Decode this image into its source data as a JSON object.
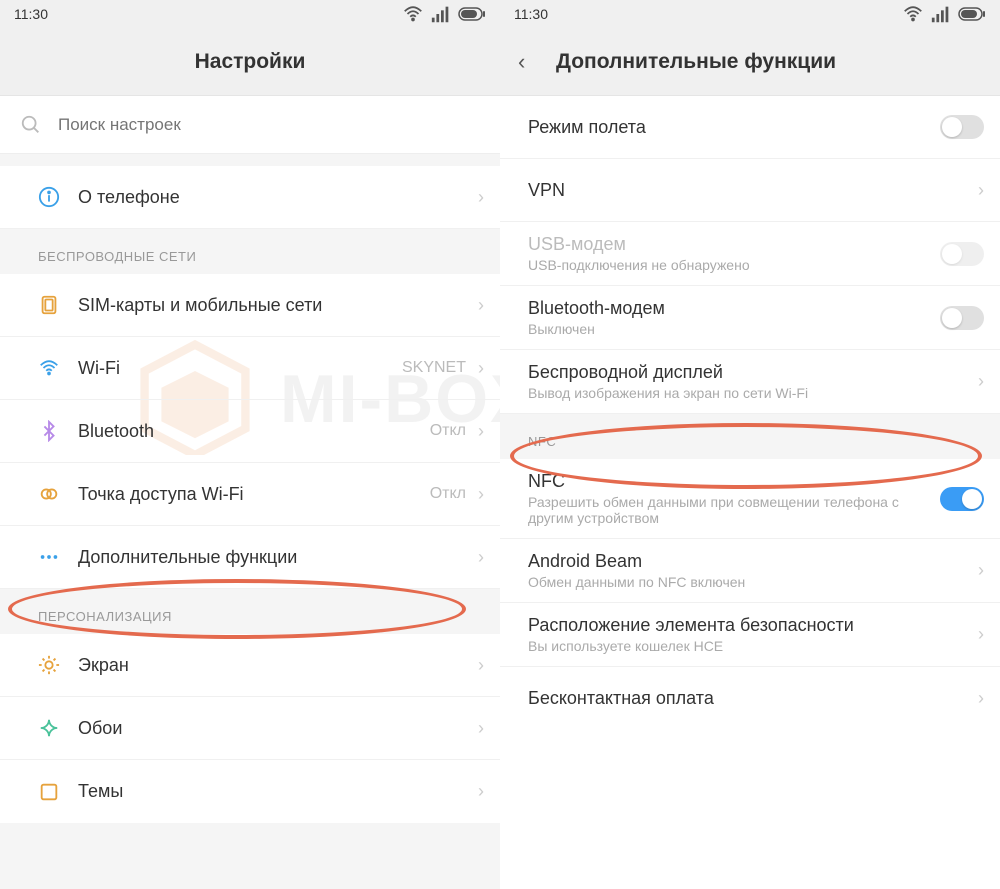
{
  "status": {
    "time": "11:30"
  },
  "left": {
    "title": "Настройки",
    "search_placeholder": "Поиск настроек",
    "about": "О телефоне",
    "section_wireless": "БЕСПРОВОДНЫЕ СЕТИ",
    "sim": "SIM-карты и мобильные сети",
    "wifi": {
      "label": "Wi-Fi",
      "value": "SKYNET"
    },
    "bluetooth": {
      "label": "Bluetooth",
      "value": "Откл"
    },
    "hotspot": {
      "label": "Точка доступа Wi-Fi",
      "value": "Откл"
    },
    "more": "Дополнительные функции",
    "section_personal": "ПЕРСОНАЛИЗАЦИЯ",
    "display": "Экран",
    "wallpaper": "Обои",
    "themes": "Темы"
  },
  "right": {
    "title": "Дополнительные функции",
    "airplane": "Режим полета",
    "vpn": "VPN",
    "usb": {
      "label": "USB-модем",
      "sub": "USB-подключения не обнаружено"
    },
    "bt_modem": {
      "label": "Bluetooth-модем",
      "sub": "Выключен"
    },
    "cast": {
      "label": "Беспроводной дисплей",
      "sub": "Вывод изображения на экран по сети Wi-Fi"
    },
    "section_nfc": "NFC",
    "nfc": {
      "label": "NFC",
      "sub": "Разрешить обмен данными при совмещении телефона с другим устройством"
    },
    "beam": {
      "label": "Android Beam",
      "sub": "Обмен данными по NFC включен"
    },
    "sec_elem": {
      "label": "Расположение элемента безопасности",
      "sub": "Вы используете кошелек HCE"
    },
    "tap_pay": "Бесконтактная оплата"
  },
  "watermark": "MI-BOX.RU"
}
